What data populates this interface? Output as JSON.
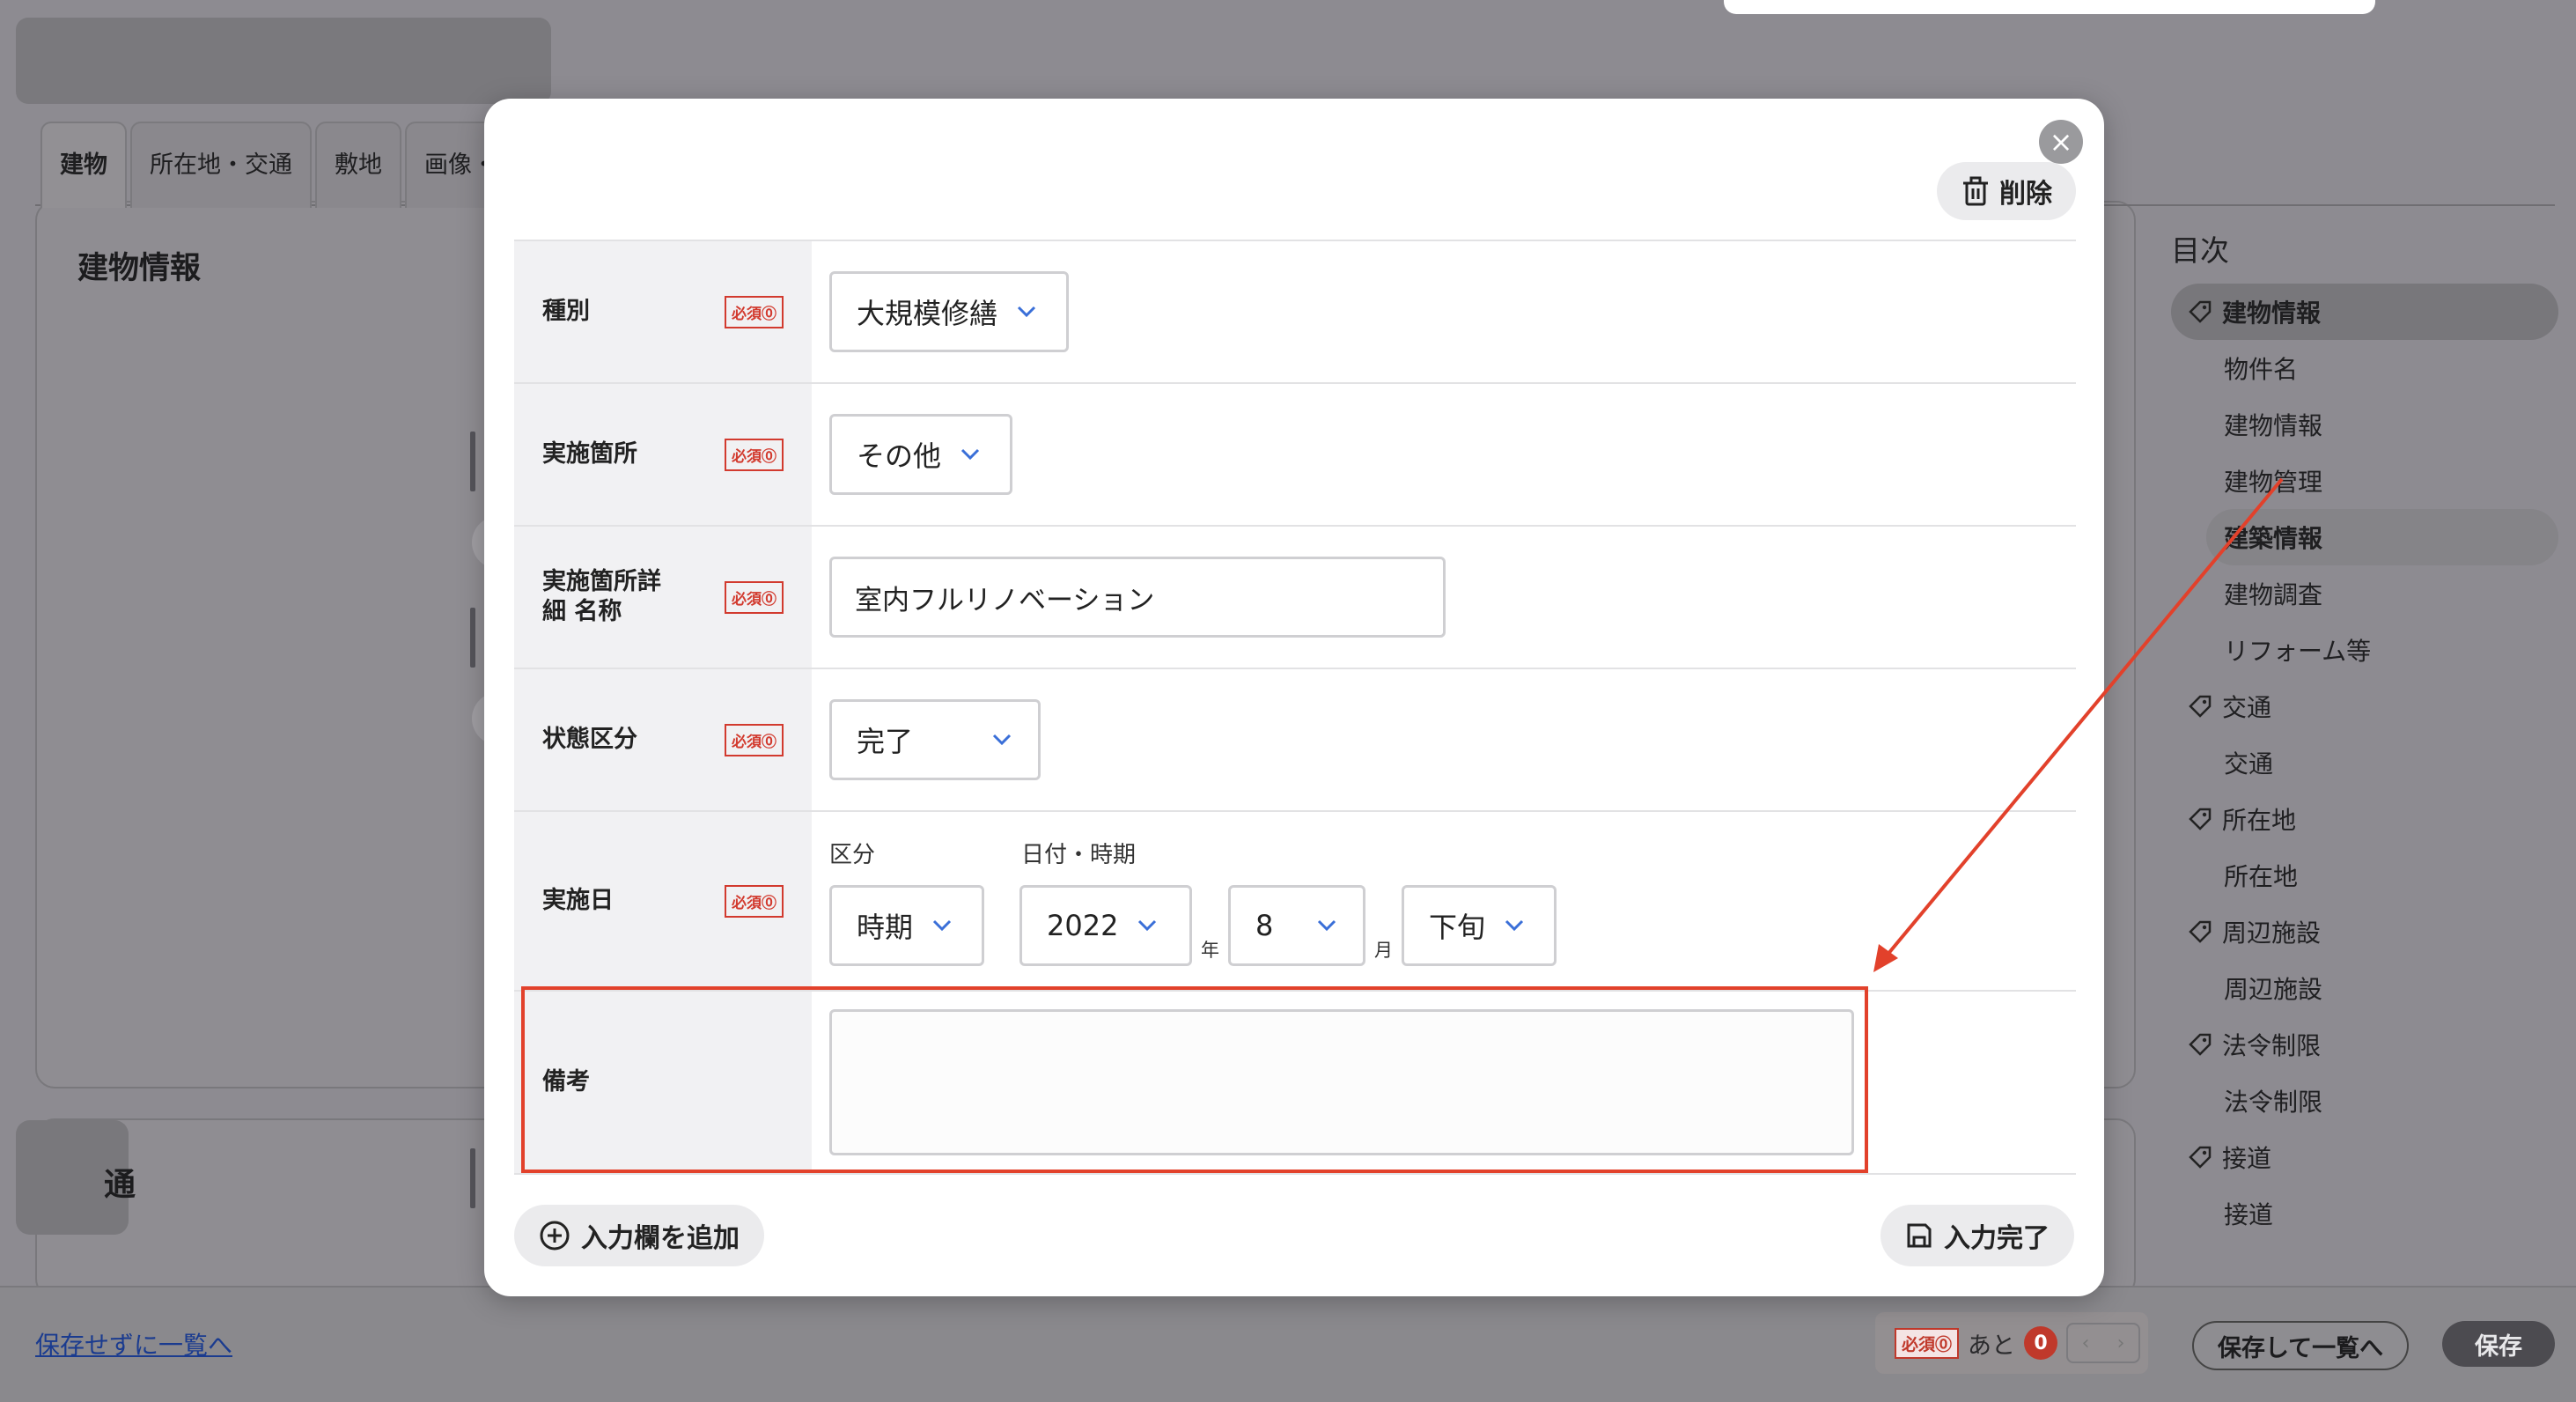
{
  "tabs": [
    {
      "label": "建物"
    },
    {
      "label": "所在地・交通"
    },
    {
      "label": "敷地"
    },
    {
      "label": "画像・"
    }
  ],
  "background": {
    "card_title": "建物情報",
    "card2_label": "通"
  },
  "toc": {
    "title": "目次",
    "items": [
      {
        "label": "建物情報",
        "kind": "section"
      },
      {
        "label": "物件名",
        "kind": "sub"
      },
      {
        "label": "建物情報",
        "kind": "sub"
      },
      {
        "label": "建物管理",
        "kind": "sub"
      },
      {
        "label": "建築情報",
        "kind": "sub"
      },
      {
        "label": "建物調査",
        "kind": "sub"
      },
      {
        "label": "リフォーム等",
        "kind": "sub"
      },
      {
        "label": "交通",
        "kind": "section"
      },
      {
        "label": "交通",
        "kind": "sub"
      },
      {
        "label": "所在地",
        "kind": "section"
      },
      {
        "label": "所在地",
        "kind": "sub"
      },
      {
        "label": "周辺施設",
        "kind": "section"
      },
      {
        "label": "周辺施設",
        "kind": "sub"
      },
      {
        "label": "法令制限",
        "kind": "section"
      },
      {
        "label": "法令制限",
        "kind": "sub"
      },
      {
        "label": "接道",
        "kind": "section"
      },
      {
        "label": "接道",
        "kind": "sub"
      }
    ]
  },
  "footer": {
    "back_link": "保存せずに一覧へ",
    "required_badge": "必須⓪",
    "remaining_label": "あと",
    "remaining_count": "0",
    "save_and_list": "保存して一覧へ",
    "save": "保存"
  },
  "modal": {
    "close_icon": "×",
    "delete_label": "削除",
    "required_badge": "必須⓪",
    "rows": {
      "type": {
        "label": "種別",
        "value": "大規模修繕"
      },
      "location": {
        "label": "実施箇所",
        "value": "その他"
      },
      "location_detail": {
        "label": "実施箇所詳細 名称",
        "value": "室内フルリノベーション"
      },
      "status": {
        "label": "状態区分",
        "value": "完了"
      },
      "date": {
        "label": "実施日",
        "division_label": "区分",
        "date_label": "日付・時期",
        "division_value": "時期",
        "year_value": "2022",
        "year_unit": "年",
        "month_value": "8",
        "month_unit": "月",
        "period_value": "下旬"
      },
      "remarks": {
        "label": "備考",
        "value": ""
      }
    },
    "add_field": "入力欄を追加",
    "done": "入力完了"
  },
  "colors": {
    "overlay": "#8d8b91",
    "required": "#d23a2e",
    "highlight": "#e2412b",
    "chevron": "#3a6fd8"
  }
}
